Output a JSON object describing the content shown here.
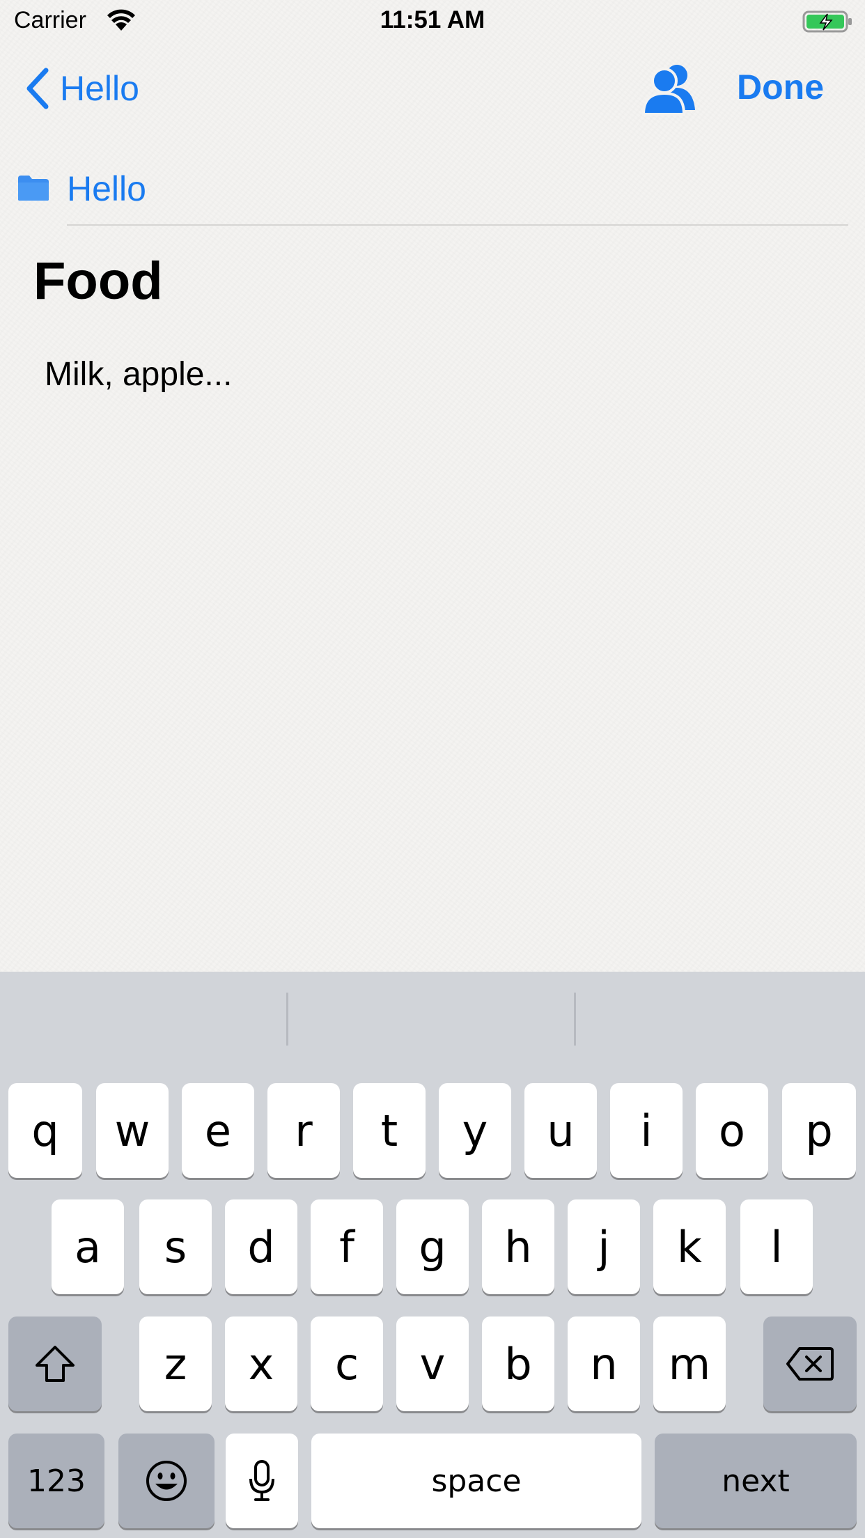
{
  "status_bar": {
    "carrier": "Carrier",
    "time": "11:51 AM"
  },
  "nav": {
    "back_label": "Hello",
    "done_label": "Done"
  },
  "folder": {
    "name": "Hello"
  },
  "note": {
    "title": "Food",
    "body": "Milk, apple..."
  },
  "keyboard": {
    "row1": [
      "q",
      "w",
      "e",
      "r",
      "t",
      "y",
      "u",
      "i",
      "o",
      "p"
    ],
    "row2": [
      "a",
      "s",
      "d",
      "f",
      "g",
      "h",
      "j",
      "k",
      "l"
    ],
    "row3": [
      "z",
      "x",
      "c",
      "v",
      "b",
      "n",
      "m"
    ],
    "numbers_label": "123",
    "space_label": "space",
    "return_label": "next"
  },
  "colors": {
    "accent": "#1a7bf0",
    "keyboard_bg": "#d1d4d9",
    "key_dark": "#abb0ba"
  }
}
